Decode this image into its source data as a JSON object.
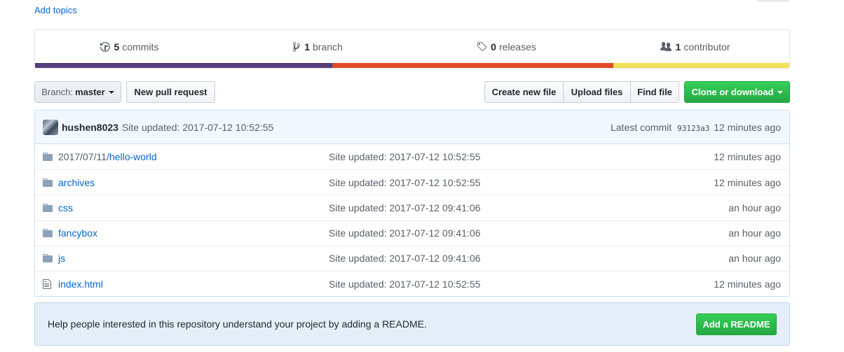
{
  "topics": {
    "add_label": "Add topics"
  },
  "summary": {
    "commits": {
      "num": "5",
      "label": "commits",
      "icon": "history-icon"
    },
    "branch": {
      "num": "1",
      "label": "branch",
      "icon": "git-branch-icon"
    },
    "releases": {
      "num": "0",
      "label": "releases",
      "icon": "tag-icon"
    },
    "contributors": {
      "num": "1",
      "label": "contributor",
      "icon": "people-icon"
    }
  },
  "language_colors": [
    "#563d7c",
    "#e34c26",
    "#f1e05a"
  ],
  "toolbar": {
    "branch_prefix": "Branch:",
    "branch_name": "master",
    "new_pr": "New pull request",
    "create_file": "Create new file",
    "upload_files": "Upload files",
    "find_file": "Find file",
    "clone": "Clone or download"
  },
  "latest_commit": {
    "author": "hushen8023",
    "message": "Site updated: 2017-07-12 10:52:55",
    "label": "Latest commit",
    "sha": "93123a3",
    "age": "12 minutes ago"
  },
  "files": [
    {
      "type": "dir",
      "prefix": "2017/07/11/",
      "name": "hello-world",
      "message": "Site updated: 2017-07-12 10:52:55",
      "age": "12 minutes ago"
    },
    {
      "type": "dir",
      "prefix": "",
      "name": "archives",
      "message": "Site updated: 2017-07-12 10:52:55",
      "age": "12 minutes ago"
    },
    {
      "type": "dir",
      "prefix": "",
      "name": "css",
      "message": "Site updated: 2017-07-12 09:41:06",
      "age": "an hour ago"
    },
    {
      "type": "dir",
      "prefix": "",
      "name": "fancybox",
      "message": "Site updated: 2017-07-12 09:41:06",
      "age": "an hour ago"
    },
    {
      "type": "dir",
      "prefix": "",
      "name": "js",
      "message": "Site updated: 2017-07-12 09:41:06",
      "age": "an hour ago"
    },
    {
      "type": "file",
      "prefix": "",
      "name": "index.html",
      "message": "Site updated: 2017-07-12 10:52:55",
      "age": "12 minutes ago"
    }
  ],
  "readme": {
    "text": "Help people interested in this repository understand your project by adding a README.",
    "button": "Add a README"
  }
}
